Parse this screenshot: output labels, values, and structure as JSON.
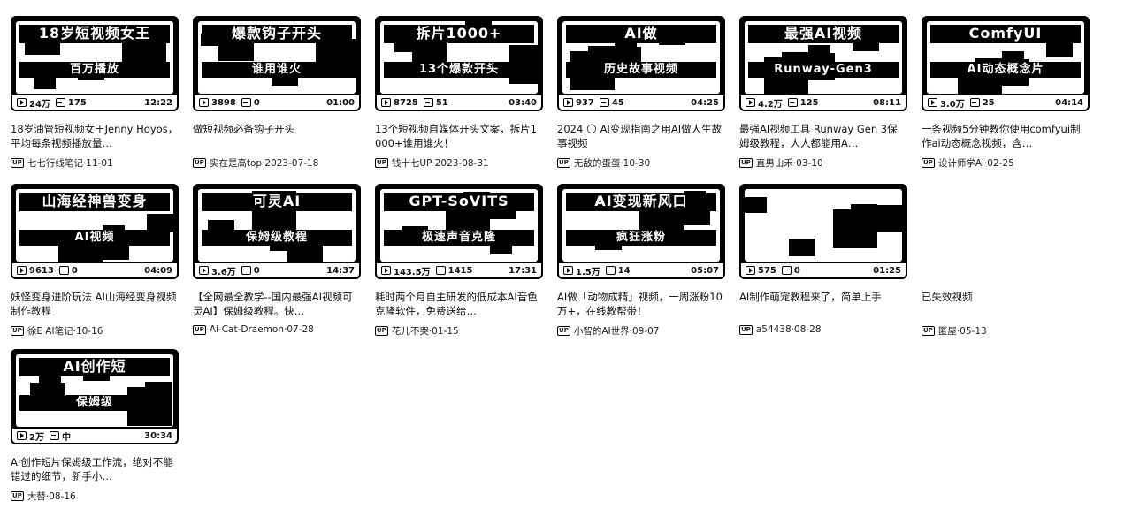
{
  "videos": [
    {
      "title": "18岁油管短视频女王Jenny Hoyos，平均每条视频播放量…",
      "author": "七七行线笔记",
      "date": "11-01",
      "views": "24万",
      "danmaku": "175",
      "duration": "12:22",
      "cap1": "18岁短视频女王",
      "cap2": "百万播放"
    },
    {
      "title": "做短视频必备钩子开头",
      "author": "实在是高top",
      "date": "2023-07-18",
      "views": "3898",
      "danmaku": "0",
      "duration": "01:00",
      "cap1": "爆款钩子开头",
      "cap2": "谁用谁火"
    },
    {
      "title": "13个短视频自媒体开头文案，拆片1000+谁用谁火！",
      "author": "钱十七UP",
      "date": "2023-08-31",
      "views": "8725",
      "danmaku": "51",
      "duration": "03:40",
      "cap1": "拆片1000+",
      "cap2": "13个爆款开头"
    },
    {
      "title": "2024 🌕 AI变现指南之用AI做人生故事视频",
      "author": "无敌的蛋蛋",
      "date": "10-30",
      "views": "937",
      "danmaku": "45",
      "duration": "04:25",
      "cap1": "AI做",
      "cap2": "历史故事视频"
    },
    {
      "title": "最强AI视频工具 Runway Gen 3保姆级教程，人人都能用A…",
      "author": "直男山禾",
      "date": "03-10",
      "views": "4.2万",
      "danmaku": "125",
      "duration": "08:11",
      "cap1": "最强AI视频",
      "cap2": "Runway-Gen3"
    },
    {
      "title": "一条视频5分钟教你使用comfyui制作ai动态概念视频，含…",
      "author": "设计师学Ai",
      "date": "02-25",
      "views": "3.0万",
      "danmaku": "25",
      "duration": "04:14",
      "cap1": "ComfyUI",
      "cap2": "AI动态概念片"
    },
    {
      "title": "妖怪变身进阶玩法 AI山海经变身视频制作教程",
      "author": "徐E AI笔记",
      "date": "10-16",
      "views": "9613",
      "danmaku": "0",
      "duration": "04:09",
      "cap1": "山海经神兽变身",
      "cap2": "AI视频"
    },
    {
      "title": "【全网最全教学--国内最强AI视频可灵AI】保姆级教程。快…",
      "author": "Ai-Cat-Draemon",
      "date": "07-28",
      "views": "3.6万",
      "danmaku": "0",
      "duration": "14:37",
      "cap1": "可灵AI",
      "cap2": "保姆级教程"
    },
    {
      "title": "耗时两个月自主研发的低成本AI音色克隆软件，免费送给…",
      "author": "花儿不哭",
      "date": "01-15",
      "views": "143.5万",
      "danmaku": "1415",
      "duration": "17:31",
      "cap1": "GPT-SoVITS",
      "cap2": "极速声音克隆"
    },
    {
      "title": "AI做「动物成精」视频，一周涨粉10万+，在线教帮带！",
      "author": "小智的AI世界",
      "date": "09-07",
      "views": "1.5万",
      "danmaku": "14",
      "duration": "05:07",
      "cap1": "AI变现新风口",
      "cap2": "疯狂涨粉"
    },
    {
      "title": "AI制作萌宠教程来了，简单上手",
      "author": "a54438",
      "date": "08-28",
      "views": "575",
      "danmaku": "0",
      "duration": "01:25",
      "cap1": "",
      "cap2": ""
    },
    {
      "title": "已失效视频",
      "author": "匿屋",
      "date": "05-13",
      "views": "",
      "danmaku": "",
      "duration": "",
      "cap1": "",
      "cap2": ""
    },
    {
      "title": "AI创作短片保姆级工作流，绝对不能错过的细节，新手小…",
      "author": "大替",
      "date": "08-16",
      "views": "2万",
      "danmaku": "中",
      "duration": "30:34",
      "cap1": "AI创作短",
      "cap2": "保姆级"
    }
  ],
  "labels": {
    "up_badge": "UP"
  }
}
